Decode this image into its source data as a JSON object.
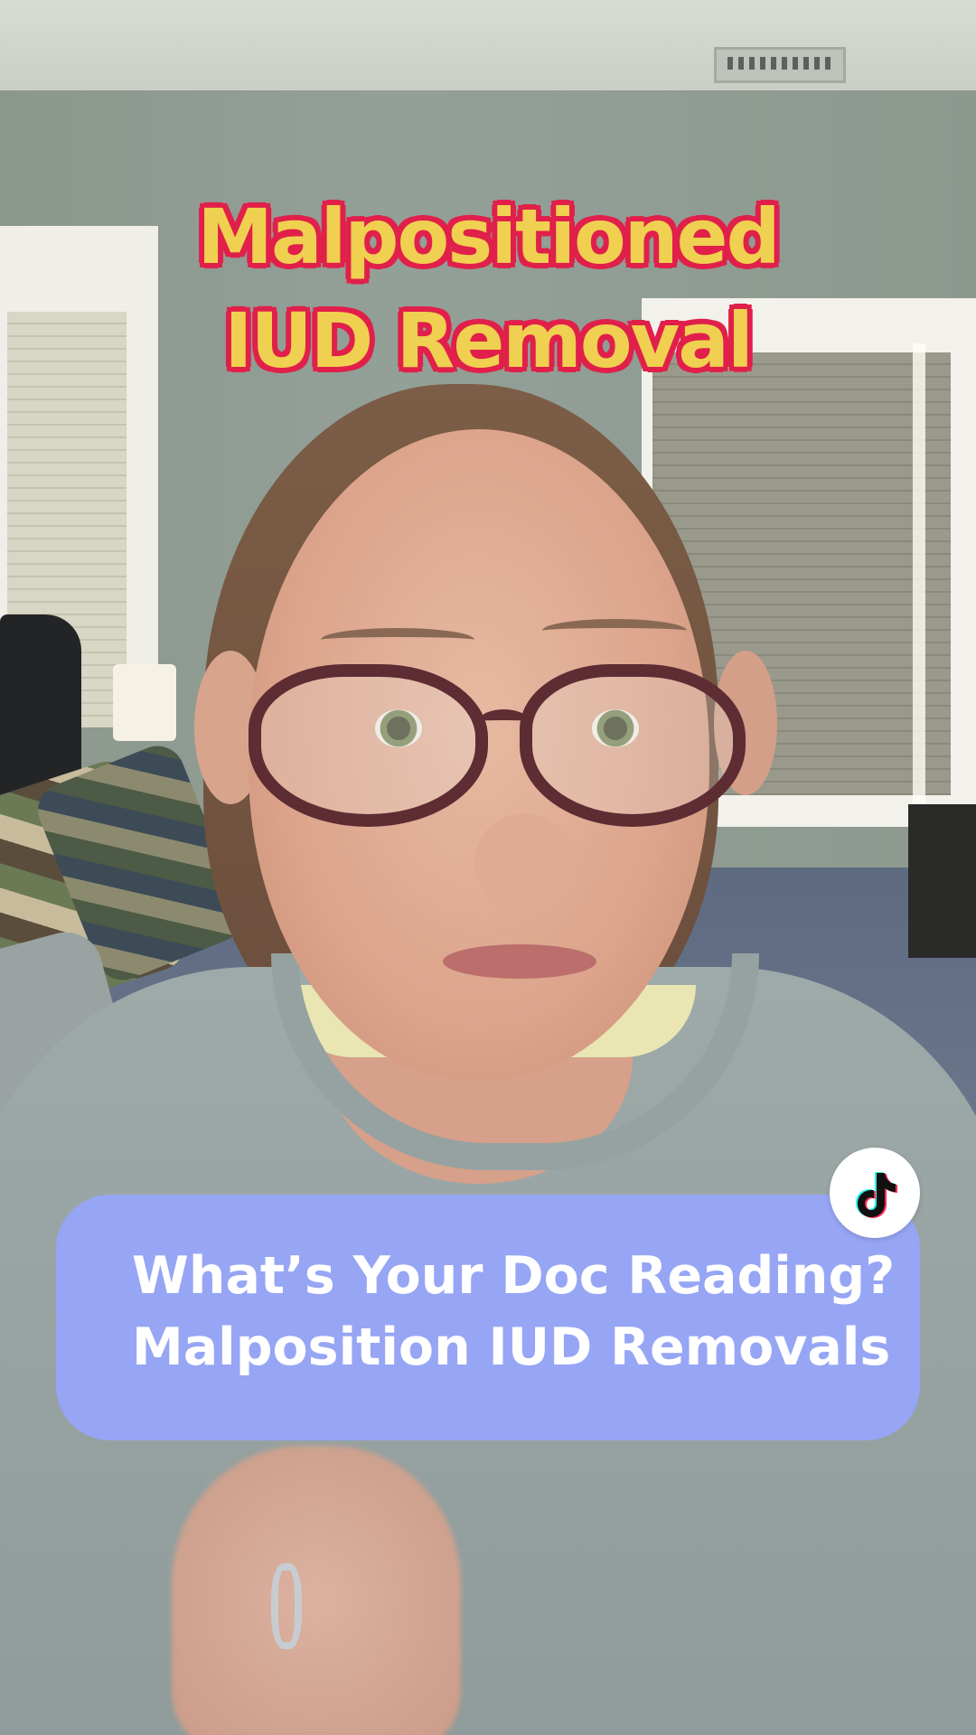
{
  "overlay_title": {
    "line1": "Malpositioned",
    "line2": "IUD Removal"
  },
  "caption_card": {
    "line1": "What’s Your Doc Reading?",
    "line2": "Malposition IUD Removals"
  },
  "badge": {
    "icon": "tiktok-logo-icon"
  },
  "colors": {
    "title_fill": "#f0d050",
    "title_outline": "#e0204a",
    "caption_card_bg": "#97a5f5",
    "caption_text": "#ffffff"
  }
}
